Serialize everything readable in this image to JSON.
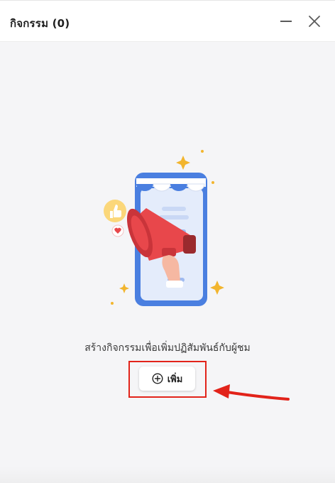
{
  "header": {
    "title": "กิจกรรม (0)",
    "minimize_icon": "minimize-icon",
    "close_icon": "close-icon"
  },
  "empty_state": {
    "illustration": "megaphone-storefront-illustration",
    "message": "สร้างกิจกรรมเพื่อเพิ่มปฏิสัมพันธ์กับผู้ชม",
    "add_button": {
      "label": "เพิ่ม",
      "icon": "plus-circle-icon"
    }
  },
  "annotations": {
    "highlight_color": "#e2231a",
    "arrow_color": "#e2231a"
  },
  "colors": {
    "background": "#f5f5f7",
    "header": "#ffffff",
    "accent_blue": "#4a7fe0",
    "megaphone_red": "#e8474b",
    "sparkle": "#f2b52e"
  }
}
